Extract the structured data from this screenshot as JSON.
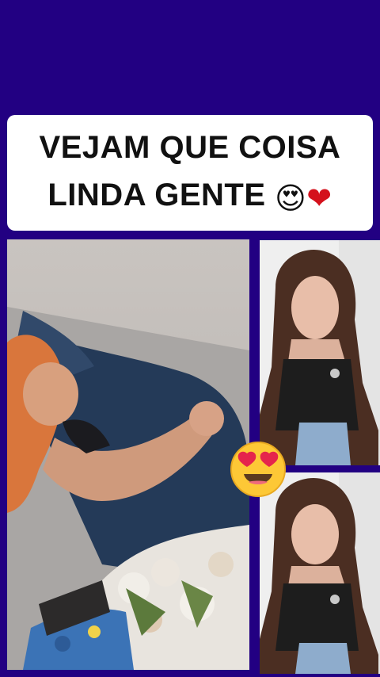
{
  "caption": {
    "line1": "VEJAM QUE COISA",
    "line2": "LINDA GENTE",
    "emoji_heart_eyes": "😍",
    "emoji_heart": "❤"
  },
  "colors": {
    "background": "#220082",
    "caption_bg": "#ffffff",
    "caption_text": "#111111",
    "heart": "#d4111c"
  },
  "icons": {
    "center_emoji": "smiling-face-heart-eyes-icon"
  }
}
